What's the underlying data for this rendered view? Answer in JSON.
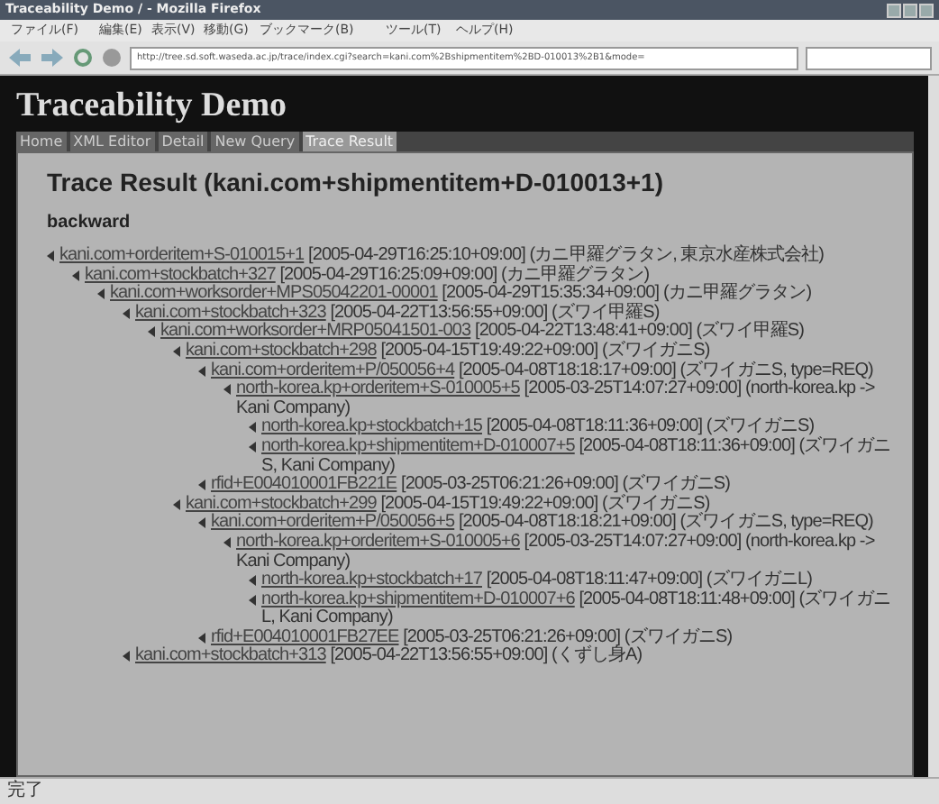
{
  "window": {
    "title": "Traceability Demo / - Mozilla Firefox"
  },
  "menu": [
    "ファイル(F)",
    "編集(E)",
    "表示(V)",
    "移動(G)",
    "ブックマーク(B)",
    "ツール(T)",
    "ヘルプ(H)"
  ],
  "address": "http://tree.sd.soft.waseda.ac.jp/trace/index.cgi?search=kani.com%2Bshipmentitem%2BD-010013%2B1&mode=",
  "page": {
    "title": "Traceability Demo",
    "nav": [
      {
        "label": "Home",
        "selected": false
      },
      {
        "label": "XML Editor",
        "selected": false
      },
      {
        "label": "Detail",
        "selected": false
      },
      {
        "label": "New Query",
        "selected": false
      },
      {
        "label": "Trace Result",
        "selected": true
      }
    ],
    "heading": "Trace Result (kani.com+shipmentitem+D-010013+1)",
    "section": "backward",
    "tree": [
      {
        "id": "kani.com+orderitem+S-010015+1",
        "detail": "[2005-04-29T16:25:10+09:00] (カニ甲羅グラタン, 東京水産株式会社)",
        "children": [
          {
            "id": "kani.com+stockbatch+327",
            "detail": "[2005-04-29T16:25:09+09:00] (カニ甲羅グラタン)",
            "children": [
              {
                "id": "kani.com+worksorder+MPS05042201-00001",
                "detail": "[2005-04-29T15:35:34+09:00] (カニ甲羅グラタン)",
                "children": [
                  {
                    "id": "kani.com+stockbatch+323",
                    "detail": "[2005-04-22T13:56:55+09:00] (ズワイ甲羅S)",
                    "children": [
                      {
                        "id": "kani.com+worksorder+MRP05041501-003",
                        "detail": "[2005-04-22T13:48:41+09:00] (ズワイ甲羅S)",
                        "children": [
                          {
                            "id": "kani.com+stockbatch+298",
                            "detail": "[2005-04-15T19:49:22+09:00] (ズワイガニS)",
                            "children": [
                              {
                                "id": "kani.com+orderitem+P/050056+4",
                                "detail": "[2005-04-08T18:18:17+09:00] (ズワイガニS, type=REQ)",
                                "children": [
                                  {
                                    "id": "north-korea.kp+orderitem+S-010005+5",
                                    "detail": "[2005-03-25T14:07:27+09:00] (north-korea.kp -> Kani Company)",
                                    "children": [
                                      {
                                        "id": "north-korea.kp+stockbatch+15",
                                        "detail": "[2005-04-08T18:11:36+09:00] (ズワイガニS)"
                                      },
                                      {
                                        "id": "north-korea.kp+shipmentitem+D-010007+5",
                                        "detail": "[2005-04-08T18:11:36+09:00] (ズワイガニS, Kani Company)"
                                      }
                                    ]
                                  }
                                ]
                              },
                              {
                                "id": "rfid+E004010001FB221E",
                                "detail": "[2005-03-25T06:21:26+09:00] (ズワイガニS)"
                              }
                            ]
                          },
                          {
                            "id": "kani.com+stockbatch+299",
                            "detail": "[2005-04-15T19:49:22+09:00] (ズワイガニS)",
                            "children": [
                              {
                                "id": "kani.com+orderitem+P/050056+5",
                                "detail": "[2005-04-08T18:18:21+09:00] (ズワイガニS, type=REQ)",
                                "children": [
                                  {
                                    "id": "north-korea.kp+orderitem+S-010005+6",
                                    "detail": "[2005-03-25T14:07:27+09:00] (north-korea.kp -> Kani Company)",
                                    "children": [
                                      {
                                        "id": "north-korea.kp+stockbatch+17",
                                        "detail": "[2005-04-08T18:11:47+09:00] (ズワイガニL)"
                                      },
                                      {
                                        "id": "north-korea.kp+shipmentitem+D-010007+6",
                                        "detail": "[2005-04-08T18:11:48+09:00] (ズワイガニL, Kani Company)"
                                      }
                                    ]
                                  }
                                ]
                              },
                              {
                                "id": "rfid+E004010001FB27EE",
                                "detail": "[2005-03-25T06:21:26+09:00] (ズワイガニS)"
                              }
                            ]
                          }
                        ]
                      }
                    ]
                  },
                  {
                    "id": "kani.com+stockbatch+313",
                    "detail": "[2005-04-22T13:56:55+09:00] (くずし身A)"
                  }
                ]
              }
            ]
          }
        ]
      }
    ]
  },
  "status_bar": "完了"
}
